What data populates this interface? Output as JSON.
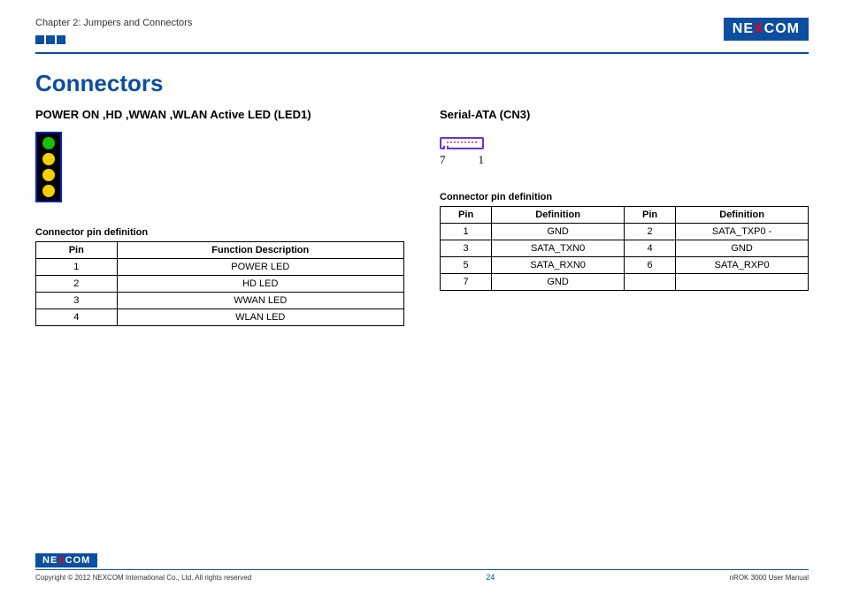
{
  "header": {
    "chapter": "Chapter 2: Jumpers and Connectors",
    "brand_pre": "NE",
    "brand_x": "X",
    "brand_post": "COM"
  },
  "title": "Connectors",
  "left": {
    "heading": "POWER ON ,HD ,WWAN ,WLAN  Active LED (LED1)",
    "caption": "Connector pin definition",
    "th_pin": "Pin",
    "th_func": "Function Description",
    "rows": [
      {
        "pin": "1",
        "func": "POWER LED"
      },
      {
        "pin": "2",
        "func": "HD LED"
      },
      {
        "pin": "3",
        "func": "WWAN LED"
      },
      {
        "pin": "4",
        "func": "WLAN LED"
      }
    ]
  },
  "right": {
    "heading": "Serial-ATA (CN3)",
    "pin_hi": "7",
    "pin_lo": "1",
    "caption": "Connector pin definition",
    "th_pin": "Pin",
    "th_def": "Definition",
    "rows": [
      {
        "p1": "1",
        "d1": "GND",
        "p2": "2",
        "d2": "SATA_TXP0 -"
      },
      {
        "p1": "3",
        "d1": "SATA_TXN0",
        "p2": "4",
        "d2": "GND"
      },
      {
        "p1": "5",
        "d1": "SATA_RXN0",
        "p2": "6",
        "d2": "SATA_RXP0"
      },
      {
        "p1": "7",
        "d1": "GND",
        "p2": "",
        "d2": ""
      }
    ]
  },
  "footer": {
    "copyright": "Copyright © 2012 NEXCOM International Co., Ltd. All rights reserved",
    "page": "24",
    "manual": "nROK 3000 User Manual",
    "brand_pre": "NE",
    "brand_x": "X",
    "brand_post": "COM"
  }
}
